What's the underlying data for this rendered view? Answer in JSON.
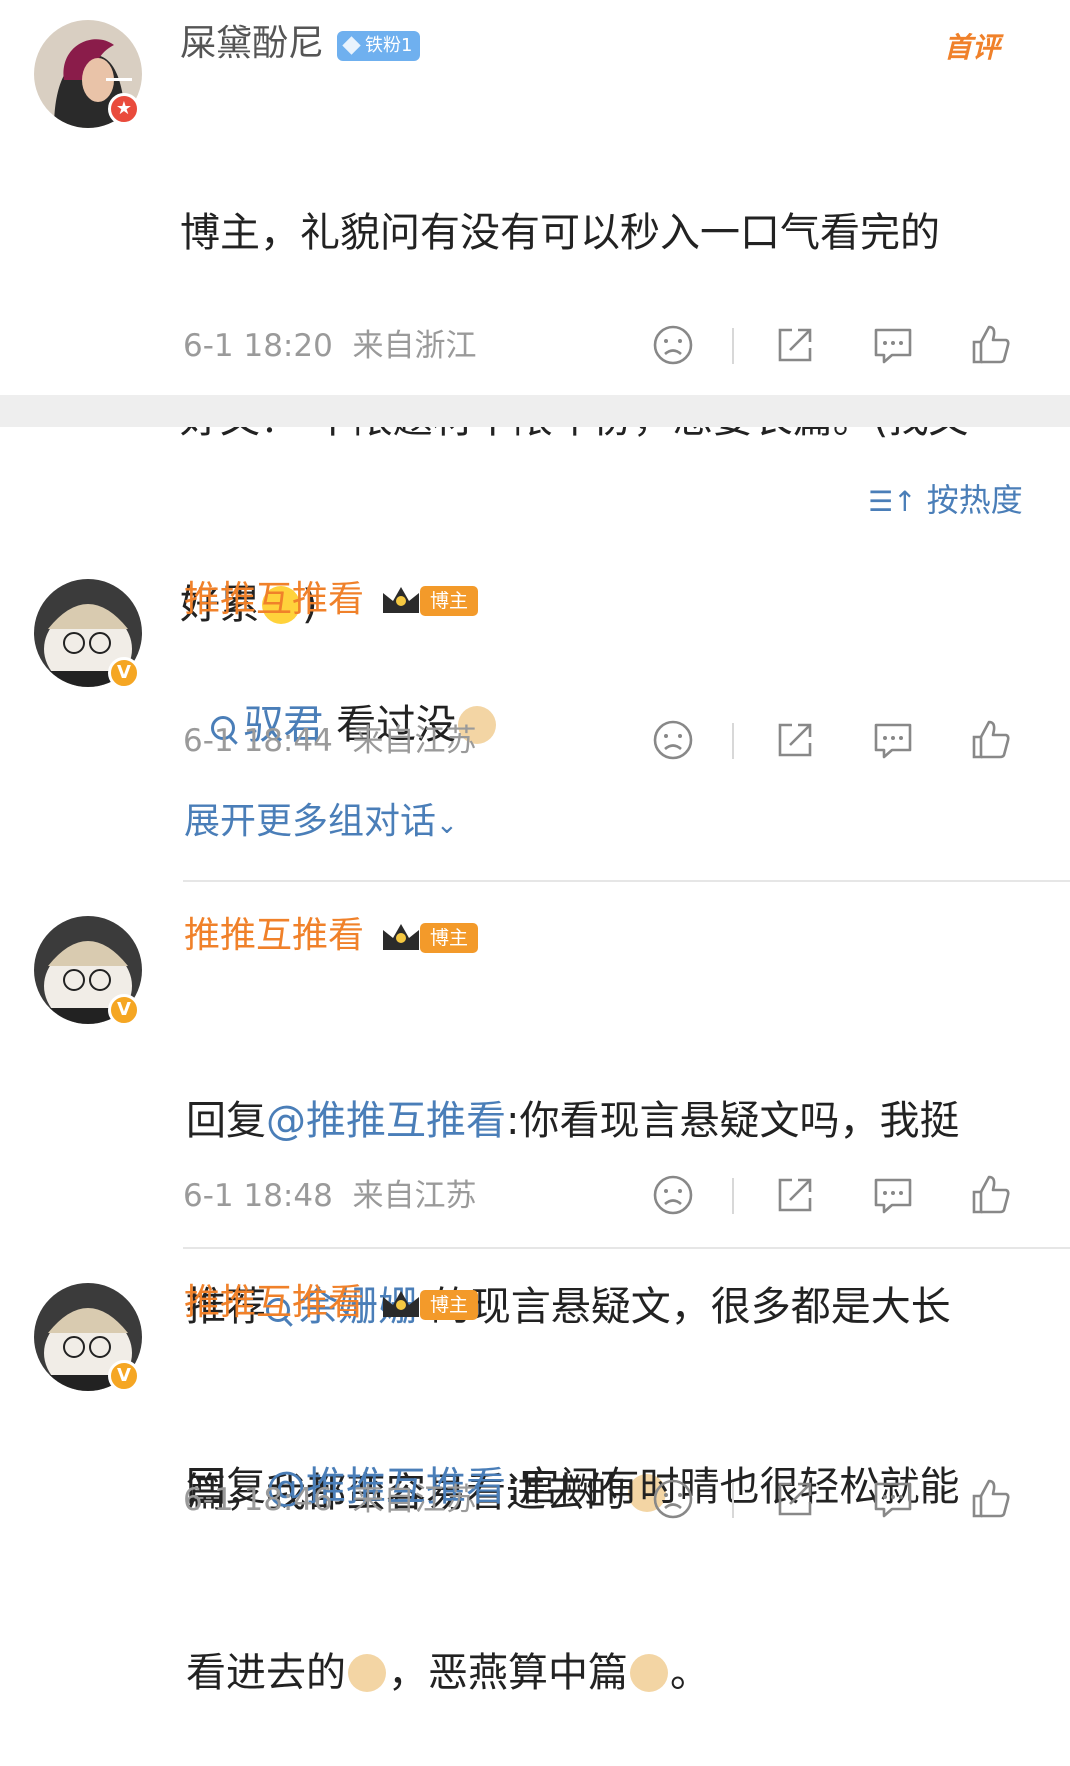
{
  "post": {
    "user": {
      "name": "屎黛酚尼",
      "fan_badge": "铁粉1",
      "avatar": "avatar-woman-icon"
    },
    "first_comment_tag": "首评",
    "text_lines": [
      "博主，礼貌问有没有可以秒入一口气看完的",
      "好文？ 不限题材不限年份，想要长篇。(找文",
      "好累"
    ],
    "text_end": ")",
    "time": "6-1 18:20",
    "location": "来自浙江"
  },
  "sort_label": "按热度",
  "comments": [
    {
      "user": {
        "name": "推推互推看",
        "role_badge": "博主"
      },
      "prefix_link": "驭君",
      "text": " 看过没",
      "time": "6-1 18:44",
      "location": "来自江苏",
      "expand": "展开更多组对话"
    },
    {
      "user": {
        "name": "推推互推看",
        "role_badge": "博主"
      },
      "reply_word": "回复",
      "mention": "@推推互推看",
      "line1_rest": ":你看现言悬疑文吗，我挺",
      "line2_start": "推荐",
      "line2_link": "余姗姗",
      "line2_rest": " 的现言悬疑文，很多都是大长",
      "line3": "篇，我都蛮容易看进去的",
      "time": "6-1 18:48",
      "location": "来自江苏"
    },
    {
      "user": {
        "name": "推推互推看",
        "role_badge": "博主"
      },
      "reply_word": "回复",
      "mention": "@推推互推看",
      "line1_rest": ":宫阙有时晴也很轻松就能",
      "line2_a": "看进去的",
      "line2_b": "，恶燕算中篇",
      "line2_c": "。",
      "time": "6-1 18:46",
      "location": "来自江苏"
    }
  ],
  "icons": {
    "dislike": "dislike-face-icon",
    "share": "share-icon",
    "comment": "comment-icon",
    "like": "like-icon"
  },
  "colors": {
    "accent_blue": "#4a7eb8",
    "name_orange": "#f0812a",
    "badge_orange": "#f39a2a",
    "fan_blue": "#6fb0ef"
  }
}
